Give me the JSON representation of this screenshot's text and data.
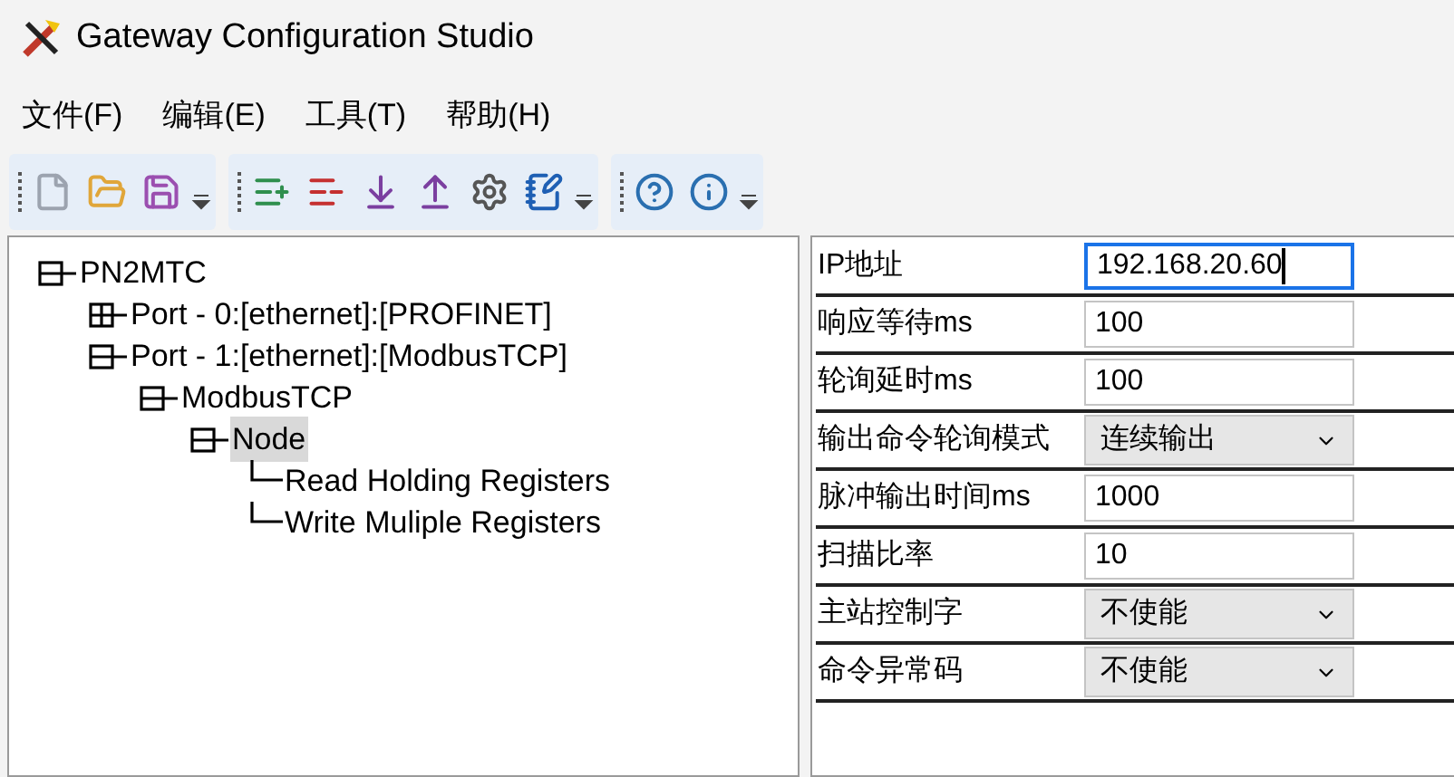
{
  "window": {
    "title": "Gateway Configuration Studio"
  },
  "menu": [
    "文件(F)",
    "编辑(E)",
    "工具(T)",
    "帮助(H)"
  ],
  "toolbar": [
    {
      "tools": [
        {
          "kind": "new"
        },
        {
          "kind": "open"
        },
        {
          "kind": "save"
        }
      ]
    },
    {
      "tools": [
        {
          "kind": "add"
        },
        {
          "kind": "remove"
        },
        {
          "kind": "download"
        },
        {
          "kind": "upload"
        },
        {
          "kind": "settings"
        },
        {
          "kind": "notes"
        }
      ]
    },
    {
      "tools": [
        {
          "kind": "help"
        },
        {
          "kind": "info"
        }
      ]
    }
  ],
  "tree": [
    {
      "label": "PN2MTC",
      "expanded": true,
      "selected": false,
      "children": [
        {
          "label": "Port - 0:[ethernet]:[PROFINET]",
          "expanded": false,
          "selected": false
        },
        {
          "label": "Port - 1:[ethernet]:[ModbusTCP]",
          "expanded": true,
          "selected": false,
          "children": [
            {
              "label": "ModbusTCP",
              "expanded": true,
              "selected": false,
              "children": [
                {
                  "label": "Node",
                  "expanded": true,
                  "selected": true,
                  "children": [
                    {
                      "label": "Read Holding Registers",
                      "selected": false
                    },
                    {
                      "label": "Write Muliple Registers",
                      "selected": false
                    }
                  ]
                }
              ]
            }
          ]
        }
      ]
    }
  ],
  "properties": [
    {
      "label": "IP地址",
      "kind": "input",
      "value": "192.168.20.60",
      "focused": true
    },
    {
      "label": "响应等待ms",
      "kind": "input",
      "value": "100",
      "focused": false
    },
    {
      "label": "轮询延时ms",
      "kind": "input",
      "value": "100",
      "focused": false
    },
    {
      "label": "输出命令轮询模式",
      "kind": "select",
      "value": "连续输出"
    },
    {
      "label": "脉冲输出时间ms",
      "kind": "input",
      "value": "1000",
      "focused": false
    },
    {
      "label": "扫描比率",
      "kind": "input",
      "value": "10",
      "focused": false
    },
    {
      "label": "主站控制字",
      "kind": "select",
      "value": "不使能"
    },
    {
      "label": "命令异常码",
      "kind": "select",
      "value": "不使能"
    }
  ]
}
